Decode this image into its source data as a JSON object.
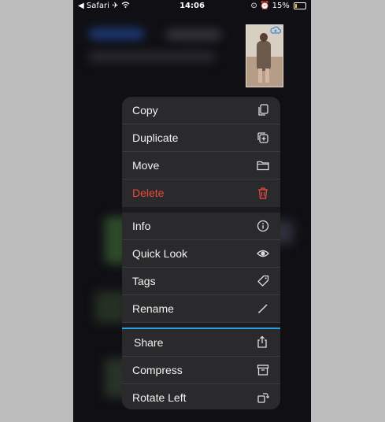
{
  "status_bar": {
    "back_app": "◀ Safari",
    "time": "14:06",
    "battery": "15%"
  },
  "menu": {
    "items": [
      {
        "label": "Copy",
        "icon": "copy-icon"
      },
      {
        "label": "Duplicate",
        "icon": "duplicate-icon"
      },
      {
        "label": "Move",
        "icon": "folder-icon"
      },
      {
        "label": "Delete",
        "icon": "trash-icon",
        "destructive": true
      },
      {
        "label": "Info",
        "icon": "info-icon"
      },
      {
        "label": "Quick Look",
        "icon": "eye-icon"
      },
      {
        "label": "Tags",
        "icon": "tag-icon"
      },
      {
        "label": "Rename",
        "icon": "pencil-icon"
      },
      {
        "label": "Share",
        "icon": "share-icon",
        "selected": true
      },
      {
        "label": "Compress",
        "icon": "archive-icon"
      },
      {
        "label": "Rotate Left",
        "icon": "rotate-left-icon"
      }
    ]
  },
  "colors": {
    "destructive": "#ea4a3c",
    "selection": "#2b9fe0",
    "menu_background": "#2a2a2c"
  }
}
